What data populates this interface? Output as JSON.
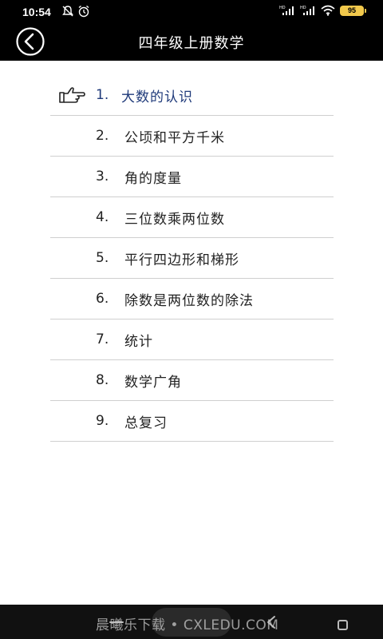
{
  "status_bar": {
    "time": "10:54",
    "battery": "95",
    "icons": [
      "mute-icon",
      "alarm-icon",
      "signal-icon",
      "signal-icon",
      "wifi-icon",
      "battery-icon"
    ]
  },
  "header": {
    "title": "四年级上册数学",
    "back_icon": "back-arrow-circle-icon"
  },
  "chapters": [
    {
      "num": "1.",
      "label": "大数的认识",
      "active": true
    },
    {
      "num": "2.",
      "label": "公顷和平方千米",
      "active": false
    },
    {
      "num": "3.",
      "label": "角的度量",
      "active": false
    },
    {
      "num": "4.",
      "label": "三位数乘两位数",
      "active": false
    },
    {
      "num": "5.",
      "label": "平行四边形和梯形",
      "active": false
    },
    {
      "num": "6.",
      "label": "除数是两位数的除法",
      "active": false
    },
    {
      "num": "7.",
      "label": "统计",
      "active": false
    },
    {
      "num": "8.",
      "label": "数学广角",
      "active": false
    },
    {
      "num": "9.",
      "label": "总复习",
      "active": false
    }
  ],
  "colors": {
    "active_text": "#1f3a7a",
    "header_bg": "#000000",
    "divider": "#cfcfcf",
    "battery": "#f2c94c"
  },
  "watermark": "晨曦乐下载 • CXLEDU.COM"
}
